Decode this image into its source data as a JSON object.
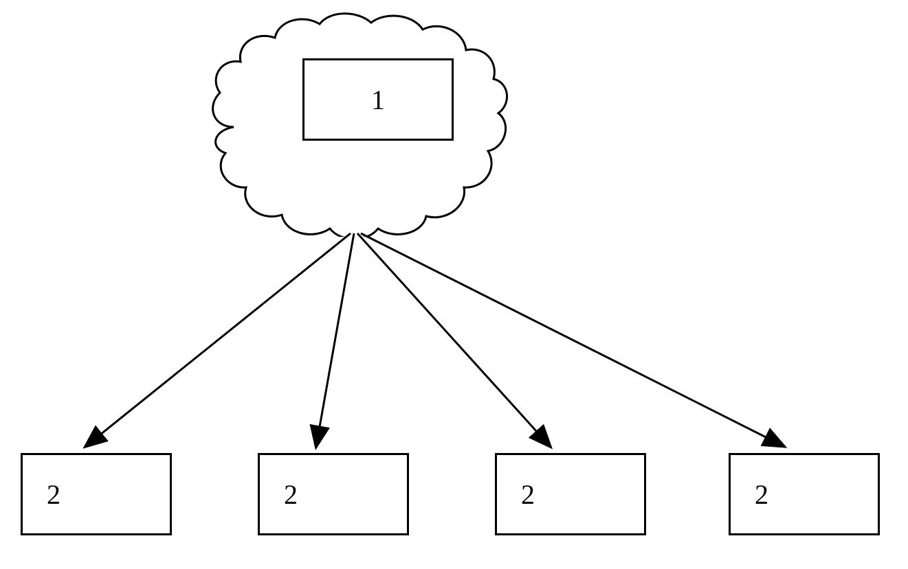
{
  "diagram": {
    "cloud": {
      "label": "1"
    },
    "boxes": [
      {
        "label": "2"
      },
      {
        "label": "2"
      },
      {
        "label": "2"
      },
      {
        "label": "2"
      }
    ]
  }
}
